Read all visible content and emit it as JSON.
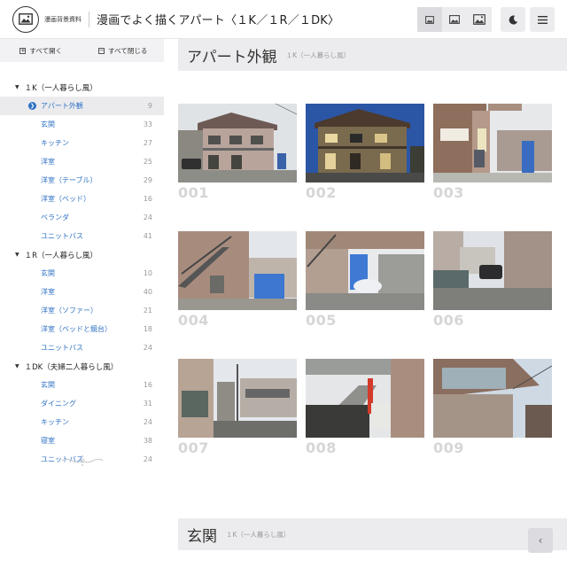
{
  "header": {
    "logo_text": "漫画背景資料",
    "title": "漫画でよく描くアパート〈１K／１R／１DK〉"
  },
  "sidebar": {
    "expand_all": "すべて開く",
    "collapse_all": "すべて閉じる",
    "groups": [
      {
        "label": "１K（一人暮らし風）",
        "items": [
          {
            "label": "アパート外観",
            "count": "9"
          },
          {
            "label": "玄関",
            "count": "33"
          },
          {
            "label": "キッチン",
            "count": "27"
          },
          {
            "label": "洋室",
            "count": "25"
          },
          {
            "label": "洋室（テーブル）",
            "count": "29"
          },
          {
            "label": "洋室（ベッド）",
            "count": "16"
          },
          {
            "label": "ベランダ",
            "count": "24"
          },
          {
            "label": "ユニットバス",
            "count": "41"
          }
        ]
      },
      {
        "label": "１R（一人暮らし風）",
        "items": [
          {
            "label": "玄関",
            "count": "10"
          },
          {
            "label": "洋室",
            "count": "40"
          },
          {
            "label": "洋室（ソファー）",
            "count": "21"
          },
          {
            "label": "洋室（ベッドと鏡台）",
            "count": "18"
          },
          {
            "label": "ユニットバス",
            "count": "24"
          }
        ]
      },
      {
        "label": "１DK（夫婦二人暮らし風）",
        "items": [
          {
            "label": "玄関",
            "count": "16"
          },
          {
            "label": "ダイニング",
            "count": "31"
          },
          {
            "label": "キッチン",
            "count": "24"
          },
          {
            "label": "寝室",
            "count": "38"
          },
          {
            "label": "ユニットバス",
            "count": "24"
          }
        ]
      }
    ]
  },
  "sections": [
    {
      "title": "アパート外観",
      "subtitle": "１K（一人暮らし風）"
    },
    {
      "title": "玄関",
      "subtitle": "１K（一人暮らし風）"
    }
  ],
  "photos": [
    "001",
    "002",
    "003",
    "004",
    "005",
    "006",
    "007",
    "008",
    "009"
  ],
  "colors": {
    "accent": "#2f72c4",
    "section_bg": "#ececee",
    "number": "#d6d6d8"
  }
}
